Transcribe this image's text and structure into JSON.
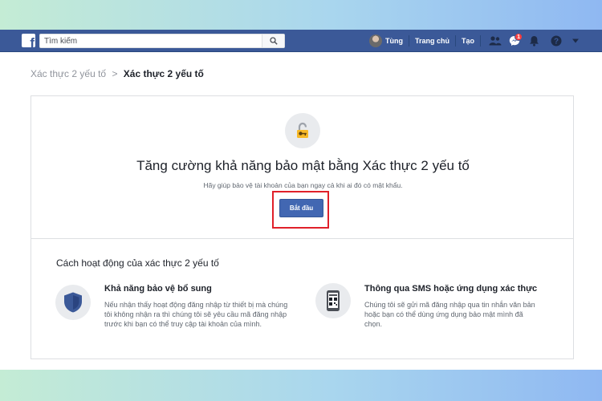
{
  "topbar": {
    "logo": "f",
    "search_placeholder": "Tìm kiếm",
    "user_name": "Tùng",
    "home_link": "Trang chủ",
    "create_link": "Tạo",
    "messages_badge": "1",
    "brand_color": "#3b5998"
  },
  "breadcrumb": {
    "parent": "Xác thực 2 yếu tố",
    "separator": ">",
    "current": "Xác thực 2 yếu tố"
  },
  "hero": {
    "icon": "lock-key-icon",
    "headline": "Tăng cường khả năng bảo mật bằng Xác thực 2 yếu tố",
    "subline": "Hãy giúp bảo vệ tài khoản của bạn ngay cả khi ai đó có mật khẩu.",
    "start_button": "Bắt đầu",
    "button_color": "#4267b2",
    "highlight_color": "#e0202a"
  },
  "how_it_works": {
    "title": "Cách hoạt động của xác thực 2 yếu tố",
    "features": [
      {
        "icon": "shield-icon",
        "title": "Khả năng bảo vệ bổ sung",
        "lines": [
          "Nếu nhận thấy hoạt động đăng nhập từ thiết bị mà chúng",
          "tôi không nhận ra thì chúng tôi sẽ yêu cầu mã đăng nhập",
          "trước khi bạn có thể truy cập tài khoản của mình."
        ]
      },
      {
        "icon": "phone-qr-icon",
        "title": "Thông qua SMS hoặc ứng dụng xác thực",
        "lines": [
          "Chúng tôi sẽ gửi mã đăng nhập qua tin nhắn văn bản",
          "hoặc bạn có thể dùng ứng dụng bảo mật mình đã",
          "chọn."
        ]
      }
    ]
  }
}
